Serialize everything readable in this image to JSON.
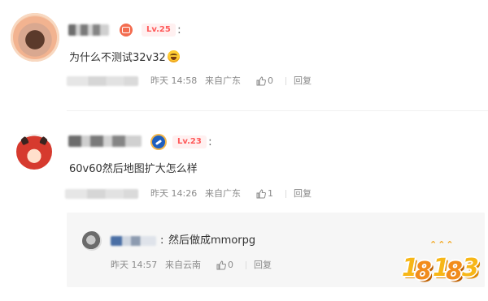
{
  "comments": [
    {
      "level": "Lv.25",
      "more": ":",
      "text": "为什么不测试32v32",
      "emoji": "grin-emoji",
      "time": "昨天 14:58",
      "location": "来自广东",
      "likes": "0",
      "reply_label": "回复"
    },
    {
      "level": "Lv.23",
      "more": ":",
      "text": "60v60然后地图扩大怎么样",
      "time": "昨天 14:26",
      "location": "来自广东",
      "likes": "1",
      "reply_label": "回复"
    }
  ],
  "reply": {
    "separator": ":",
    "text": "然后做成mmorpg",
    "time": "昨天 14:57",
    "location": "来自云南",
    "likes": "0",
    "reply_label": "回复"
  },
  "watermark": {
    "text_1": "1",
    "text_8a": "8",
    "text_1b": "1",
    "text_8b": "8",
    "text_3": "3"
  },
  "colors": {
    "level_text": "#ff5a5a",
    "level_bg": "#fff0f0",
    "meta": "#8a8a8a",
    "reply_bg": "#f6f6f6"
  }
}
